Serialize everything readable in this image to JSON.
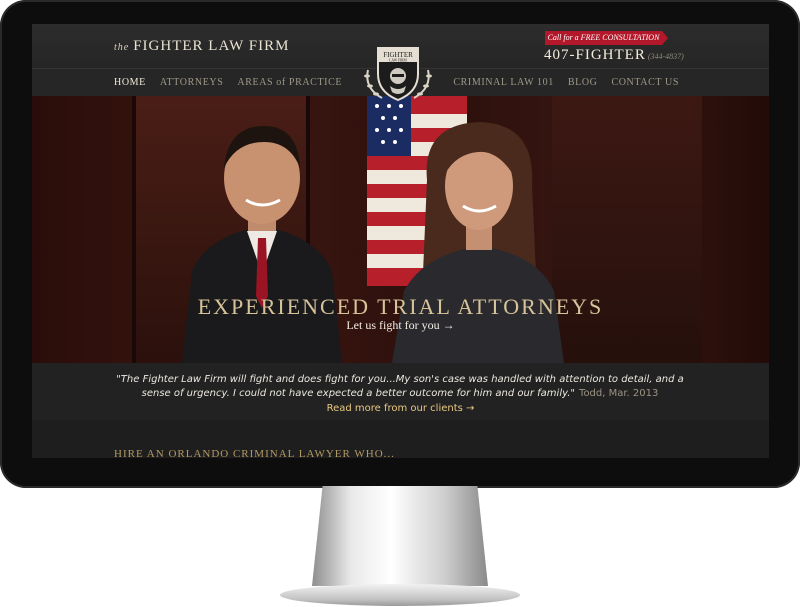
{
  "site": {
    "logo_prefix": "the",
    "logo_name": "FIGHTER LAW FIRM",
    "crest_text_top": "FIGHTER",
    "crest_text_bottom": "LAW FIRM"
  },
  "nav": {
    "left": [
      "HOME",
      "ATTORNEYS",
      "AREAS of PRACTICE"
    ],
    "right": [
      "CRIMINAL LAW 101",
      "BLOG",
      "CONTACT US"
    ]
  },
  "contact": {
    "cta": "Call for a FREE CONSULTATION",
    "phone": "407-FIGHTER",
    "phone_digits": "(344-4837)"
  },
  "hero": {
    "title": "EXPERIENCED TRIAL ATTORNEYS",
    "subtitle": "Let us fight for you →"
  },
  "testimonial": {
    "quote": "\"The Fighter Law Firm will fight and does fight for you...My son's case was handled with attention to detail, and a sense of urgency. I could not have expected a better outcome for him and our family.\"",
    "author": "Todd, Mar. 2013",
    "read_more": "Read more from our clients →"
  },
  "section": {
    "heading": "HIRE AN ORLANDO CRIMINAL LAWYER WHO..."
  },
  "colors": {
    "accent_red": "#b3172a",
    "gold": "#d7c39a",
    "link_gold": "#e8c883"
  }
}
